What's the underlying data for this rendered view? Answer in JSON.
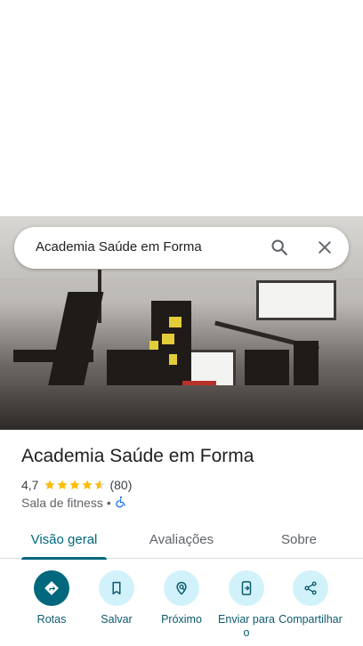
{
  "search": {
    "query": "Academia Saúde em Forma",
    "search_icon": "search-icon",
    "close_icon": "close-icon"
  },
  "place": {
    "name": "Academia Saúde em Forma",
    "rating": "4,7",
    "stars_value": 4.7,
    "stars_max": 5,
    "review_count": "(80)",
    "category": "Sala de fitness",
    "separator": "•",
    "accessibility_icon": "wheelchair-icon"
  },
  "tabs": [
    {
      "label": "Visão geral",
      "active": true
    },
    {
      "label": "Avaliações",
      "active": false
    },
    {
      "label": "Sobre",
      "active": false
    }
  ],
  "actions": [
    {
      "label": "Rotas",
      "icon": "directions-icon"
    },
    {
      "label": "Salvar",
      "icon": "bookmark-icon"
    },
    {
      "label": "Próximo",
      "icon": "nearby-icon"
    },
    {
      "label": "Enviar para o",
      "icon": "send-to-phone-icon"
    },
    {
      "label": "Compartilhar",
      "icon": "share-icon"
    }
  ],
  "colors": {
    "accent": "#00677d",
    "star": "#fbbc04",
    "action_bg": "#d2f2fb"
  }
}
